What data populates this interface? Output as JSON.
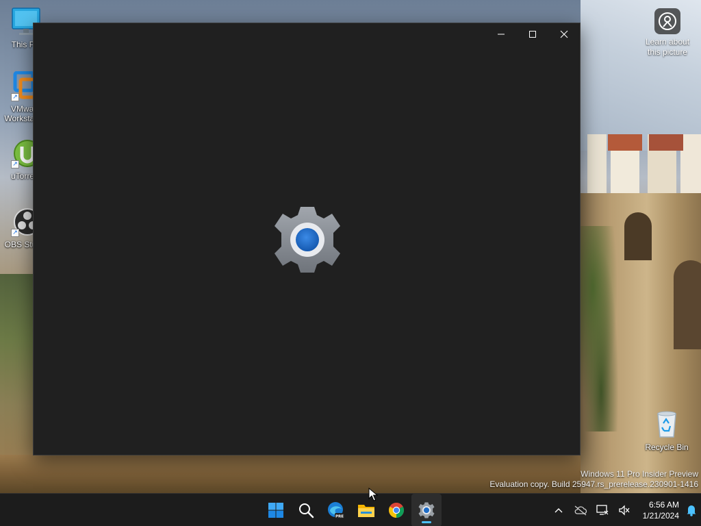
{
  "desktop": {
    "icons": [
      {
        "id": "this-pc",
        "label": "This PC",
        "icon": "monitor-icon"
      },
      {
        "id": "vmware",
        "label": "VMware\nWorkstation",
        "icon": "vmware-icon"
      },
      {
        "id": "utorrent",
        "label": "uTorrent",
        "icon": "utorrent-icon"
      },
      {
        "id": "obs",
        "label": "OBS Studio",
        "icon": "obs-icon"
      },
      {
        "id": "recycle-bin",
        "label": "Recycle Bin",
        "icon": "recycle-bin-icon"
      }
    ],
    "learn_about": {
      "label": "Learn about\nthis picture",
      "icon": "camera-pin-icon"
    },
    "watermark": {
      "line1": "Windows 11 Pro Insider Preview",
      "line2": "Evaluation copy. Build 25947.rs_prerelease.230901-1416"
    }
  },
  "window": {
    "app": "Settings",
    "splash_icon": "gear-icon",
    "controls": [
      "minimize",
      "maximize",
      "close"
    ],
    "colors": {
      "background": "#202020",
      "gear": "#8a8f96",
      "gear_center": "#1f6dc7"
    }
  },
  "taskbar": {
    "pinned": [
      {
        "id": "start",
        "icon": "windows-logo-icon"
      },
      {
        "id": "search",
        "icon": "search-icon"
      },
      {
        "id": "edge",
        "icon": "edge-dev-icon",
        "badge": "PRE"
      },
      {
        "id": "explorer",
        "icon": "file-explorer-icon"
      },
      {
        "id": "chrome",
        "icon": "chrome-icon"
      },
      {
        "id": "settings",
        "icon": "settings-gear-icon",
        "active": true
      }
    ],
    "tray": {
      "time": "6:56 AM",
      "date": "1/21/2024"
    },
    "accent": "#4cc2ff"
  }
}
